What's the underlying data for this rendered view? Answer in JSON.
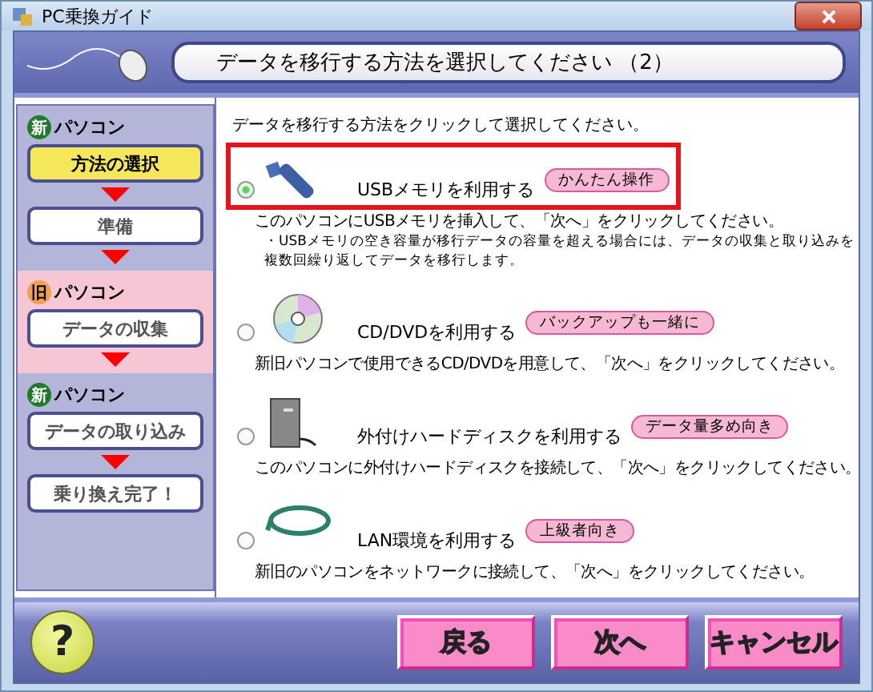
{
  "window": {
    "title": "PC乗換ガイド"
  },
  "header": {
    "title": "データを移行する方法を選択してください （2）"
  },
  "sidebar": {
    "groups": [
      {
        "kind": "new",
        "badge": "新",
        "label": "パソコン",
        "steps": [
          {
            "label": "方法の選択",
            "selected": true
          },
          {
            "label": "準備",
            "selected": false
          }
        ]
      },
      {
        "kind": "old",
        "badge": "旧",
        "label": "パソコン",
        "steps": [
          {
            "label": "データの収集",
            "selected": false
          }
        ]
      },
      {
        "kind": "new",
        "badge": "新",
        "label": "パソコン",
        "steps": [
          {
            "label": "データの取り込み",
            "selected": false
          },
          {
            "label": "乗り換え完了！",
            "selected": false
          }
        ]
      }
    ]
  },
  "content": {
    "instruction": "データを移行する方法をクリックして選択してください。",
    "options": [
      {
        "kind": "usb",
        "label": "USBメモリを利用する",
        "tag": "かんたん操作",
        "description": "このパソコンにUSBメモリを挿入して、「次へ」をクリックしてください。",
        "note": "・USBメモリの空き容量が移行データの容量を超える場合には、データの収集と取り込みを複数回繰り返してデータを移行します。",
        "selected": true,
        "highlighted": true
      },
      {
        "kind": "disc",
        "label": "CD/DVDを利用する",
        "tag": "バックアップも一緒に",
        "description": "新旧パソコンで使用できるCD/DVDを用意して、「次へ」をクリックしてください。",
        "selected": false,
        "highlighted": false
      },
      {
        "kind": "hdd",
        "label": "外付けハードディスクを利用する",
        "tag": "データ量多め向き",
        "description": "このパソコンに外付けハードディスクを接続して、「次へ」をクリックしてください。",
        "selected": false,
        "highlighted": false
      },
      {
        "kind": "lan",
        "label": "LAN環境を利用する",
        "tag": "上級者向き",
        "description": "新旧のパソコンをネットワークに接続して、「次へ」をクリックしてください。",
        "selected": false,
        "highlighted": false
      }
    ]
  },
  "footer": {
    "help": "?",
    "buttons": [
      "戻る",
      "次へ",
      "キャンセル"
    ]
  }
}
